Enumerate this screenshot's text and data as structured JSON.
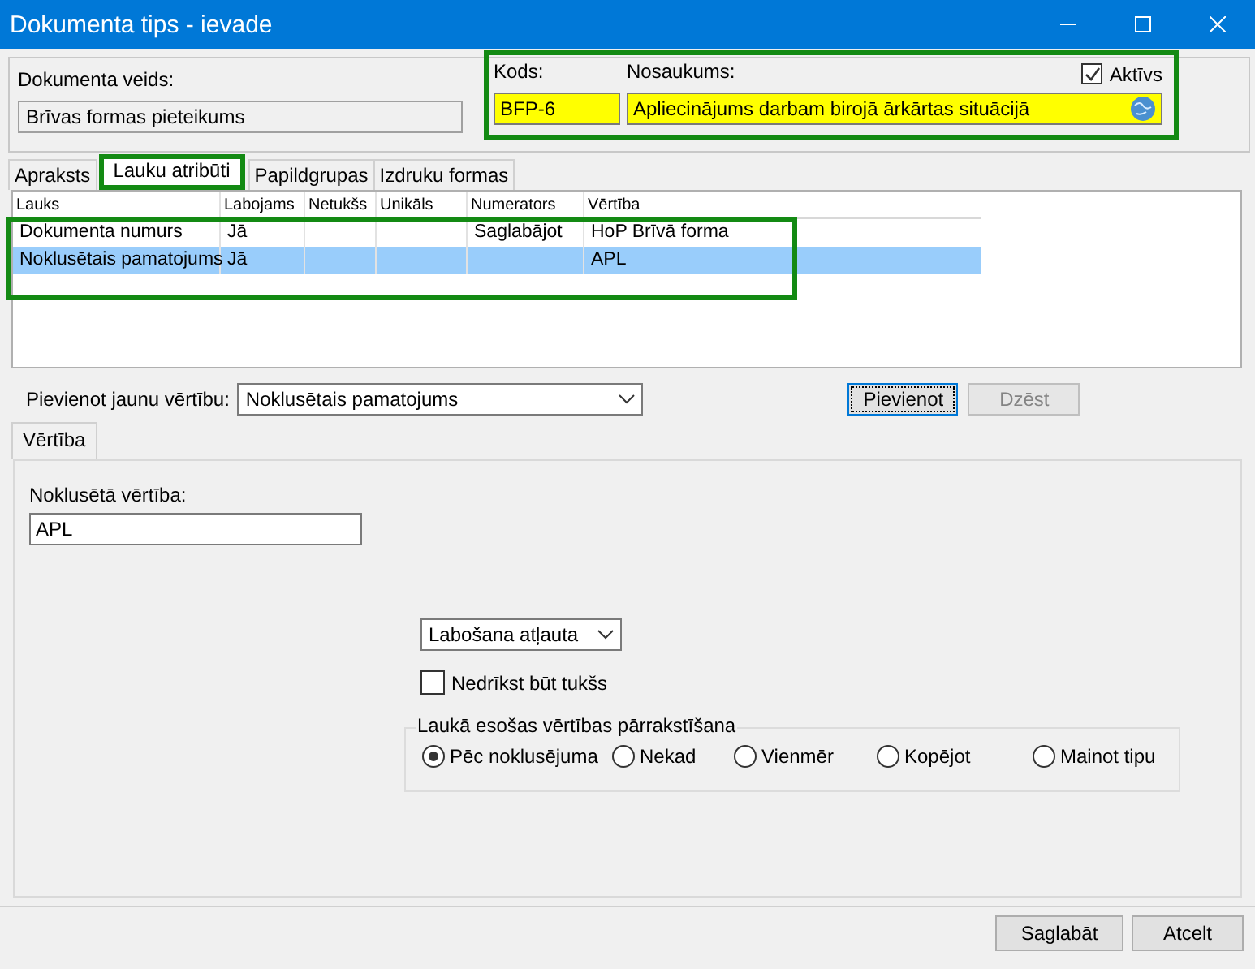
{
  "window": {
    "title": "Dokumenta tips - ievade"
  },
  "header": {
    "doc_type": {
      "label": "Dokumenta veids:",
      "value": "Brīvas formas pieteikums"
    },
    "code": {
      "label": "Kods:",
      "value": "BFP-6"
    },
    "name": {
      "label": "Nosaukums:",
      "value": "Apliecinājums darbam birojā ārkārtas situācijā"
    },
    "active": {
      "label": "Aktīvs",
      "checked": true
    }
  },
  "tabs": [
    {
      "label": "Apraksts",
      "selected": false
    },
    {
      "label": "Lauku atribūti",
      "selected": true
    },
    {
      "label": "Papildgrupas",
      "selected": false
    },
    {
      "label": "Izdruku formas",
      "selected": false
    }
  ],
  "table": {
    "columns": [
      "Lauks",
      "Labojams",
      "Netukšs",
      "Unikāls",
      "Numerators",
      "Vērtība"
    ],
    "rows": [
      {
        "cells": [
          "Dokumenta numurs",
          "Jā",
          "",
          "",
          "Saglabājot",
          "HoP Brīvā forma"
        ],
        "selected": false
      },
      {
        "cells": [
          "Noklusētais pamatojums",
          "Jā",
          "",
          "",
          "",
          "APL"
        ],
        "selected": true
      }
    ]
  },
  "add_value": {
    "label": "Pievienot jaunu vērtību:",
    "value": "Noklusētais pamatojums"
  },
  "add_buttons": [
    {
      "label": "Pievienot",
      "focused": true,
      "disabled": false
    },
    {
      "label": "Dzēst",
      "focused": false,
      "disabled": true
    }
  ],
  "subtabs": [
    {
      "label": "Vērtība",
      "selected": true
    }
  ],
  "default_value": {
    "label": "Noklusētā vērtība:",
    "value": "APL"
  },
  "edit_mode": {
    "value": "Labošana atļauta"
  },
  "not_empty": {
    "label": "Nedrīkst būt tukšs",
    "checked": false
  },
  "overwrite": {
    "title": "Laukā esošas vērtības pārrakstīšana",
    "options": [
      {
        "label": "Pēc noklusējuma",
        "selected": true
      },
      {
        "label": "Nekad",
        "selected": false
      },
      {
        "label": "Vienmēr",
        "selected": false
      },
      {
        "label": "Kopējot",
        "selected": false
      },
      {
        "label": "Mainot tipu",
        "selected": false
      }
    ]
  },
  "footer_buttons": [
    {
      "label": "Saglabāt"
    },
    {
      "label": "Atcelt"
    }
  ]
}
